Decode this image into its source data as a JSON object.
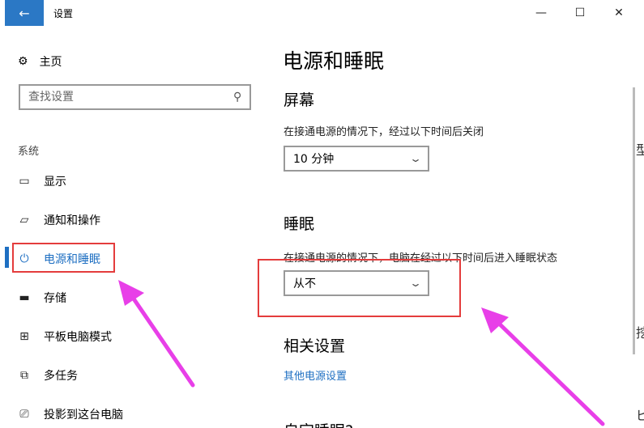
{
  "window": {
    "title": "设置",
    "back_icon": "←",
    "minimize_icon": "—",
    "maximize_icon": "☐",
    "close_icon": "✕"
  },
  "sidebar": {
    "home_label": "主页",
    "home_icon": "⚙",
    "search_placeholder": "查找设置",
    "search_icon": "⚲",
    "section_label": "系统",
    "items": [
      {
        "label": "显示",
        "icon": "▭"
      },
      {
        "label": "通知和操作",
        "icon": "▱"
      },
      {
        "label": "电源和睡眠",
        "icon": "⏻",
        "active": true
      },
      {
        "label": "存储",
        "icon": "▬"
      },
      {
        "label": "平板电脑模式",
        "icon": "⊞"
      },
      {
        "label": "多任务",
        "icon": "⧉"
      },
      {
        "label": "投影到这台电脑",
        "icon": "⎚"
      }
    ]
  },
  "main": {
    "title": "电源和睡眠",
    "screen": {
      "heading": "屏幕",
      "description": "在接通电源的情况下，经过以下时间后关闭",
      "value": "10 分钟"
    },
    "sleep": {
      "heading": "睡眠",
      "description": "在接通电源的情况下，电脑在经过以下时间后进入睡眠状态",
      "value": "从不"
    },
    "related": {
      "heading": "相关设置",
      "link": "其他电源设置"
    },
    "next_heading": "自定睡眠?"
  },
  "colors": {
    "accent": "#1e6fc2",
    "annotation_box": "#e43c3c",
    "annotation_arrow": "#e83fe8"
  },
  "right_edge_fragments": [
    "型",
    "挖",
    "ビ"
  ]
}
